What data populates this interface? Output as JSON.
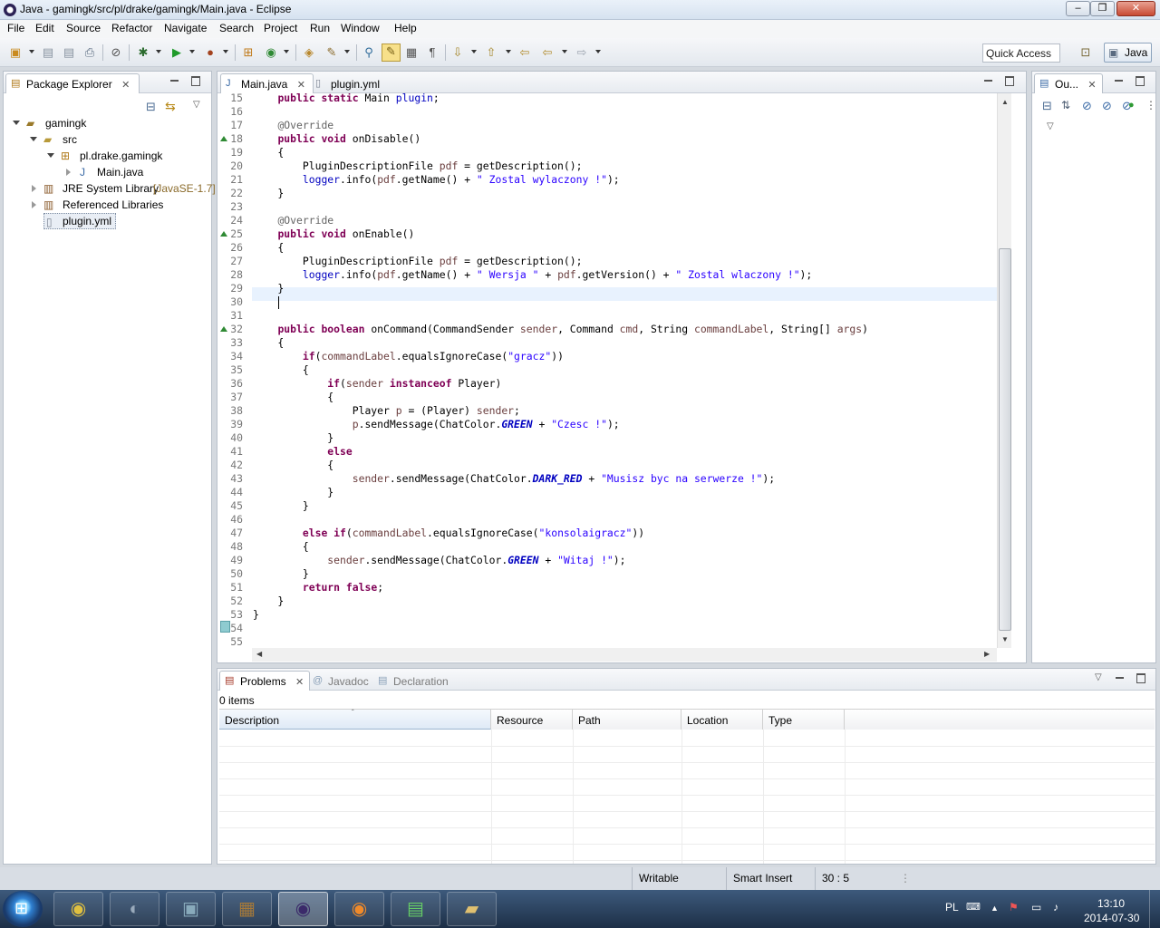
{
  "window": {
    "title": "Java - gamingk/src/pl/drake/gamingk/Main.java - Eclipse",
    "min": "–",
    "max": "❐",
    "close": "✕"
  },
  "menu": [
    "File",
    "Edit",
    "Source",
    "Refactor",
    "Navigate",
    "Search",
    "Project",
    "Run",
    "Window",
    "Help"
  ],
  "toolbar": {
    "quick_access": "Quick Access",
    "perspective": "Java"
  },
  "package_explorer": {
    "title": "Package Explorer",
    "tree": [
      {
        "label": "gamingk",
        "icon": "project-icon"
      },
      {
        "label": "src",
        "icon": "source-folder-icon"
      },
      {
        "label": "pl.drake.gamingk",
        "icon": "package-icon"
      },
      {
        "label": "Main.java",
        "icon": "java-file-icon"
      },
      {
        "label": "JRE System Library",
        "suffix": "[JavaSE-1.7]",
        "icon": "library-icon"
      },
      {
        "label": "Referenced Libraries",
        "icon": "library-icon"
      },
      {
        "label": "plugin.yml",
        "icon": "file-icon"
      }
    ]
  },
  "editor": {
    "tabs": [
      {
        "label": "Main.java"
      },
      {
        "label": "plugin.yml"
      }
    ],
    "lines": [
      {
        "n": "15",
        "t": "    public static Main plugin;"
      },
      {
        "n": "16",
        "t": ""
      },
      {
        "n": "17",
        "t": "    @Override"
      },
      {
        "n": "18",
        "t": "    public void onDisable()"
      },
      {
        "n": "19",
        "t": "    {"
      },
      {
        "n": "20",
        "t": "        PluginDescriptionFile pdf = getDescription();"
      },
      {
        "n": "21",
        "t": "        logger.info(pdf.getName() + \" Zostal wylaczony !\");"
      },
      {
        "n": "22",
        "t": "    }"
      },
      {
        "n": "23",
        "t": ""
      },
      {
        "n": "24",
        "t": "    @Override"
      },
      {
        "n": "25",
        "t": "    public void onEnable()"
      },
      {
        "n": "26",
        "t": "    {"
      },
      {
        "n": "27",
        "t": "        PluginDescriptionFile pdf = getDescription();"
      },
      {
        "n": "28",
        "t": "        logger.info(pdf.getName() + \" Wersja \" + pdf.getVersion() + \" Zostal wlaczony !\");"
      },
      {
        "n": "29",
        "t": "    }"
      },
      {
        "n": "30",
        "t": "    "
      },
      {
        "n": "31",
        "t": ""
      },
      {
        "n": "32",
        "t": "    public boolean onCommand(CommandSender sender, Command cmd, String commandLabel, String[] args)"
      },
      {
        "n": "33",
        "t": "    {"
      },
      {
        "n": "34",
        "t": "        if(commandLabel.equalsIgnoreCase(\"gracz\"))"
      },
      {
        "n": "35",
        "t": "        {"
      },
      {
        "n": "36",
        "t": "            if(sender instanceof Player)"
      },
      {
        "n": "37",
        "t": "            {"
      },
      {
        "n": "38",
        "t": "                Player p = (Player) sender;"
      },
      {
        "n": "39",
        "t": "                p.sendMessage(ChatColor.GREEN + \"Czesc !\");"
      },
      {
        "n": "40",
        "t": "            }"
      },
      {
        "n": "41",
        "t": "            else"
      },
      {
        "n": "42",
        "t": "            {"
      },
      {
        "n": "43",
        "t": "                sender.sendMessage(ChatColor.DARK_RED + \"Musisz byc na serwerze !\");"
      },
      {
        "n": "44",
        "t": "            }"
      },
      {
        "n": "45",
        "t": "        }"
      },
      {
        "n": "46",
        "t": ""
      },
      {
        "n": "47",
        "t": "        else if(commandLabel.equalsIgnoreCase(\"konsolaigracz\"))"
      },
      {
        "n": "48",
        "t": "        {"
      },
      {
        "n": "49",
        "t": "            sender.sendMessage(ChatColor.GREEN + \"Witaj !\");"
      },
      {
        "n": "50",
        "t": "        }"
      },
      {
        "n": "51",
        "t": "        return false;"
      },
      {
        "n": "52",
        "t": "    }"
      },
      {
        "n": "53",
        "t": "}"
      },
      {
        "n": "54",
        "t": ""
      },
      {
        "n": "55",
        "t": ""
      }
    ]
  },
  "outline": {
    "title": "Ou..."
  },
  "bottom": {
    "tabs": [
      {
        "label": "Problems"
      },
      {
        "label": "Javadoc"
      },
      {
        "label": "Declaration"
      }
    ],
    "count": "0 items",
    "columns": [
      "Description",
      "Resource",
      "Path",
      "Location",
      "Type"
    ]
  },
  "status": {
    "writable": "Writable",
    "insert_mode": "Smart Insert",
    "position": "30 : 5"
  },
  "taskbar": {
    "lang": "PL",
    "time": "13:10",
    "date": "2014-07-30"
  }
}
